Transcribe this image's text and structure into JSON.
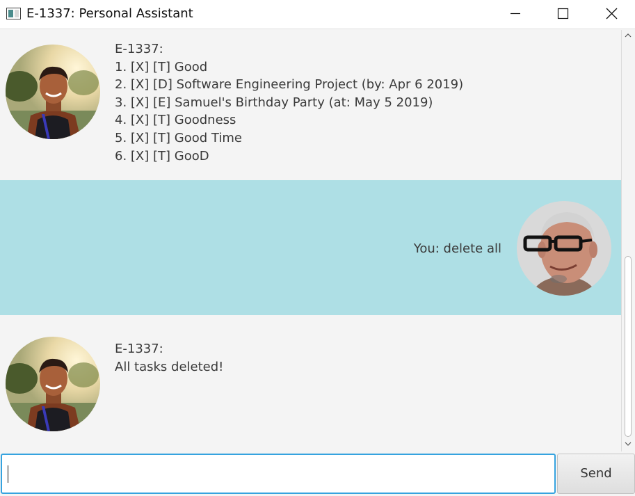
{
  "window": {
    "title": "E-1337: Personal Assistant"
  },
  "icons": {
    "app": "app-window-icon",
    "minimize": "minimize-icon",
    "maximize": "maximize-icon",
    "close": "close-icon",
    "bot_avatar": "bot-avatar",
    "user_avatar": "user-avatar"
  },
  "messages": [
    {
      "sender": "bot",
      "lines": [
        "E-1337:",
        "1. [X] [T] Good",
        "2. [X] [D] Software Engineering Project (by: Apr 6 2019)",
        "3. [X] [E] Samuel's Birthday Party (at: May 5 2019)",
        "4. [X] [T] Goodness",
        "5. [X] [T] Good Time",
        "6. [X] [T] GooD"
      ]
    },
    {
      "sender": "user",
      "text": "You: delete all"
    },
    {
      "sender": "bot",
      "lines": [
        "E-1337:",
        "All tasks deleted!"
      ]
    }
  ],
  "input": {
    "value": "",
    "placeholder": ""
  },
  "send_button": {
    "label": "Send"
  },
  "colors": {
    "user_bubble": "#aedfe5",
    "chat_background": "#f4f4f4",
    "input_focus_border": "#36a3df"
  }
}
